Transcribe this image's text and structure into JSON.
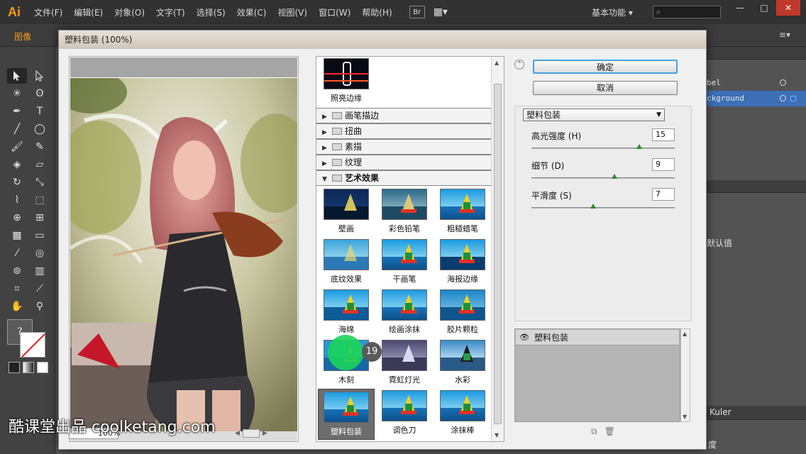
{
  "app": {
    "logo": "Ai",
    "menus": [
      "文件(F)",
      "编辑(E)",
      "对象(O)",
      "文字(T)",
      "选择(S)",
      "效果(C)",
      "视图(V)",
      "窗口(W)",
      "帮助(H)"
    ],
    "bridge_label": "Br",
    "workspace": "基本功能",
    "workspace_arrow": "▾",
    "search_icon": "search-icon",
    "window_buttons": {
      "minimize": "—",
      "maximize": "□",
      "close": "✕"
    }
  },
  "option_bar": {
    "doc_label": "图像"
  },
  "right_panel": {
    "layer_rows": [
      {
        "label": "bel"
      },
      {
        "label": "ckground"
      }
    ],
    "reset_label": "默认值",
    "kuler_label": "Kuler",
    "bottom_label": "度"
  },
  "dialog": {
    "title": "塑料包装 (100%)",
    "zoom_value": "100%",
    "gallery": {
      "top_item": {
        "label": "照亮边缘"
      },
      "folders": [
        {
          "label": "画笔描边",
          "open": false
        },
        {
          "label": "扭曲",
          "open": false
        },
        {
          "label": "素描",
          "open": false
        },
        {
          "label": "纹理",
          "open": false
        },
        {
          "label": "艺术效果",
          "open": true
        }
      ],
      "thumbs": [
        {
          "label": "壁画"
        },
        {
          "label": "彩色铅笔"
        },
        {
          "label": "粗糙蜡笔"
        },
        {
          "label": "底纹效果"
        },
        {
          "label": "干画笔"
        },
        {
          "label": "海报边缘"
        },
        {
          "label": "海绵"
        },
        {
          "label": "绘画涂抹"
        },
        {
          "label": "胶片颗粒"
        },
        {
          "label": "木刻"
        },
        {
          "label": "霓虹灯光"
        },
        {
          "label": "水彩"
        },
        {
          "label": "塑料包装"
        },
        {
          "label": "调色刀"
        },
        {
          "label": "涂抹棒"
        }
      ],
      "selected": "塑料包装"
    },
    "ok_label": "确定",
    "cancel_label": "取消",
    "filter_select": "塑料包装",
    "params": [
      {
        "label": "高光强度 (H)",
        "value": "15",
        "level": 0.75
      },
      {
        "label": "细节 (D)",
        "value": "9",
        "level": 0.58
      },
      {
        "label": "平滑度 (S)",
        "value": "7",
        "level": 0.43
      }
    ],
    "effect_layer": "塑料包装"
  },
  "overlay": {
    "step_number": "19",
    "watermark": "酷课堂出品 coolketang.com"
  },
  "colors": {
    "accent": "#f79a1e",
    "ok_border": "#49a0e0",
    "click_dot": "#19d45a",
    "selected_layer": "#3c6fb6"
  }
}
